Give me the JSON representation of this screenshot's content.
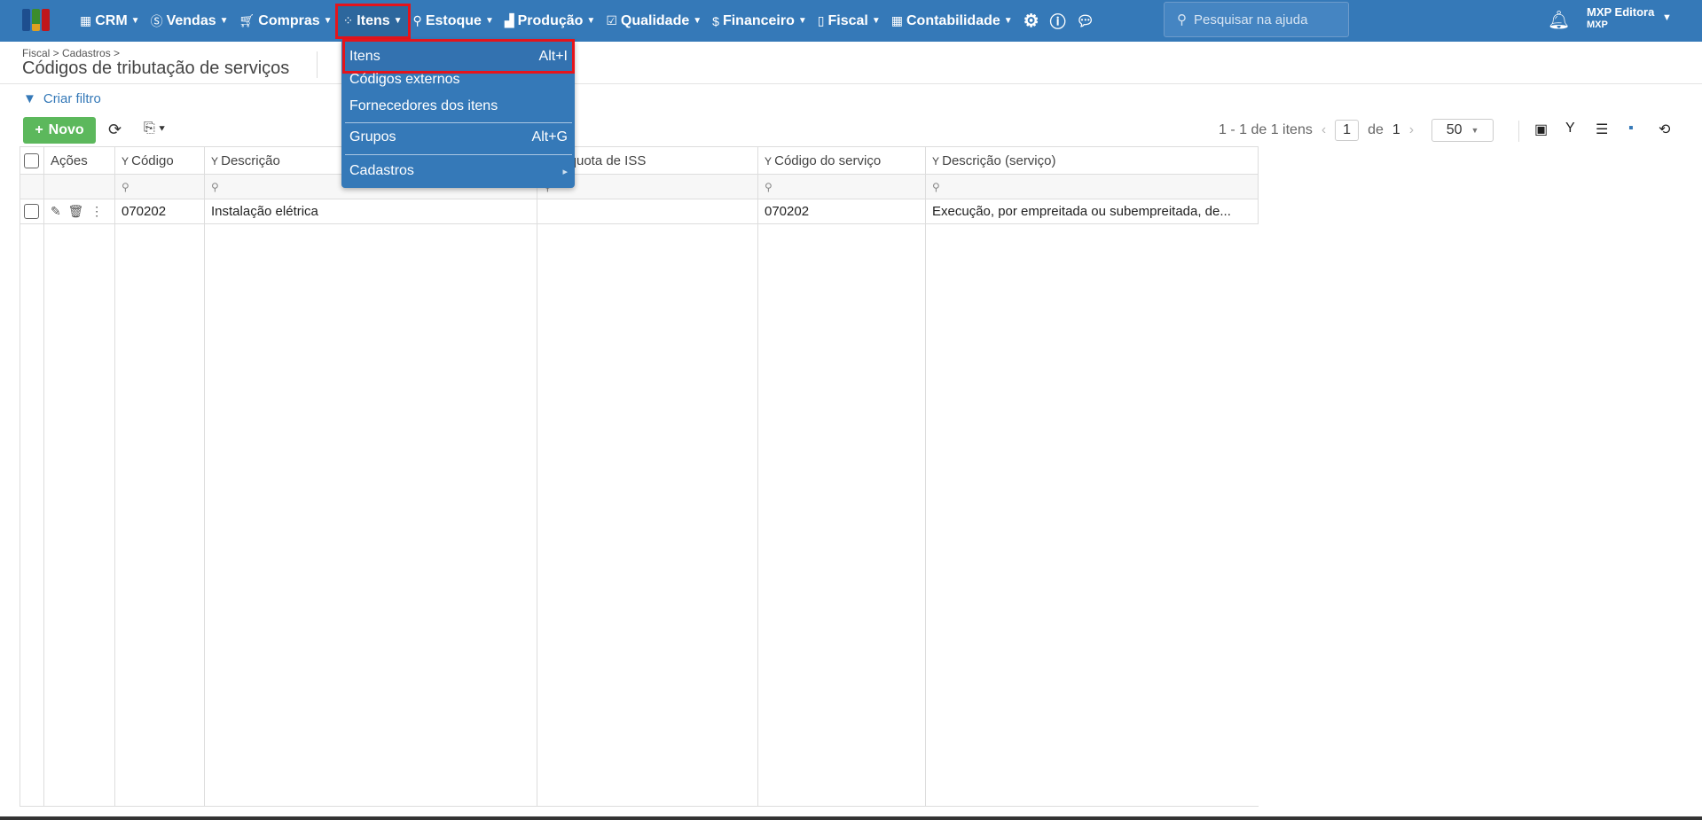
{
  "nav": {
    "items": [
      {
        "label": "CRM",
        "icon": "building-icon"
      },
      {
        "label": "Vendas",
        "icon": "dollar-icon"
      },
      {
        "label": "Compras",
        "icon": "cart-icon"
      },
      {
        "label": "Itens",
        "icon": "items-icon"
      },
      {
        "label": "Estoque",
        "icon": "dolly-icon"
      },
      {
        "label": "Produção",
        "icon": "factory-icon"
      },
      {
        "label": "Qualidade",
        "icon": "checklist-icon"
      },
      {
        "label": "Financeiro",
        "icon": "moneybag-icon"
      },
      {
        "label": "Fiscal",
        "icon": "document-icon"
      },
      {
        "label": "Contabilidade",
        "icon": "calculator-icon"
      }
    ],
    "search_placeholder": "Pesquisar na ajuda",
    "user_name": "MXP Editora",
    "user_company": "MXP"
  },
  "breadcrumb": "Fiscal > Cadastros >",
  "title": "Códigos de tributação de serviços",
  "filter_label": "Criar filtro",
  "new_label": "Novo",
  "pager": {
    "summary": "1 - 1 de 1 itens",
    "page": "1",
    "of": "de",
    "total": "1",
    "size": "50"
  },
  "table": {
    "headers": [
      "Ações",
      "Código",
      "Descrição",
      "Alíquota de ISS",
      "Código do serviço",
      "Descrição (serviço)"
    ],
    "rows": [
      {
        "codigo": "070202",
        "descricao": "Instalação elétrica",
        "aliquota": "",
        "codigo_servico": "070202",
        "descricao_servico": "Execução, por empreitada ou subempreitada, de..."
      }
    ]
  },
  "menu": {
    "items": [
      {
        "label": "Itens",
        "shortcut": "Alt+I"
      },
      {
        "label": "Códigos externos",
        "shortcut": ""
      },
      {
        "label": "Fornecedores dos itens",
        "shortcut": ""
      },
      {
        "label": "Grupos",
        "shortcut": "Alt+G"
      },
      {
        "label": "Cadastros",
        "shortcut": "▸"
      }
    ]
  }
}
